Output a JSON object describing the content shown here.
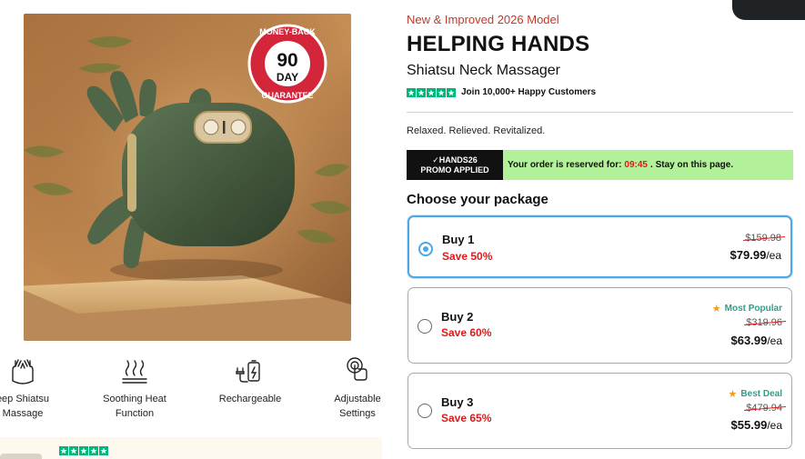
{
  "product": {
    "eyebrow": "New & Improved 2026 Model",
    "title": "HELPING HANDS",
    "subtitle": "Shiatsu Neck Massager",
    "trust_text": "Join 10,000+ Happy Customers",
    "tagline": "Relaxed. Relieved. Revitalized."
  },
  "image": {
    "badge_line1": "MONEY-BACK",
    "badge_number": "90",
    "badge_unit": "DAY",
    "badge_line2": "GUARANTEE"
  },
  "promo": {
    "code": "✓HANDS26",
    "status": "PROMO APPLIED",
    "message_prefix": "Your order is reserved for:",
    "timer": "09:45",
    "message_suffix": "Stay on this page."
  },
  "packages_heading": "Choose your package",
  "packages": [
    {
      "name": "Buy 1",
      "save": "Save 50%",
      "badge": "",
      "old_price": "$159.98",
      "price": "$79.99",
      "per": "/ea",
      "selected": true
    },
    {
      "name": "Buy 2",
      "save": "Save 60%",
      "badge": "Most Popular",
      "old_price": "$319.96",
      "price": "$63.99",
      "per": "/ea",
      "selected": false
    },
    {
      "name": "Buy 3",
      "save": "Save 65%",
      "badge": "Best Deal",
      "old_price": "$479.94",
      "price": "$55.99",
      "per": "/ea",
      "selected": false
    }
  ],
  "features": [
    {
      "icon": "hands-icon",
      "label_line1": "eep Shiatsu",
      "label_line2": "Massage"
    },
    {
      "icon": "heat-icon",
      "label_line1": "Soothing Heat",
      "label_line2": "Function"
    },
    {
      "icon": "battery-plug-icon",
      "label_line1": "Rechargeable",
      "label_line2": ""
    },
    {
      "icon": "touch-icon",
      "label_line1": "Adjustable",
      "label_line2": "Settings"
    }
  ],
  "colors": {
    "accent_red": "#e01919",
    "eyebrow_red": "#c0392b",
    "selected_blue": "#4aa8e8",
    "promo_green": "#b3f09a",
    "trust_green": "#00b67a",
    "badge_teal": "#2f9d8a",
    "device_green": "#4a5e43"
  }
}
